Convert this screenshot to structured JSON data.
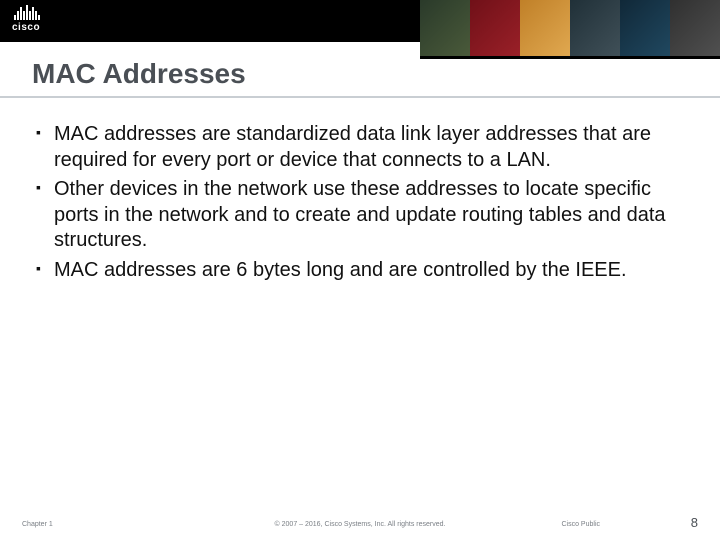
{
  "brand": "cisco",
  "title": "MAC Addresses",
  "bullets": [
    "MAC addresses are standardized data link layer addresses that are required for every port or device that connects to a LAN.",
    "Other devices in the network use these addresses to locate specific ports in the network and to create and update routing tables and data structures.",
    "MAC addresses are 6 bytes long and are controlled by the IEEE."
  ],
  "footer": {
    "chapter": "Chapter 1",
    "copyright": "© 2007 – 2016, Cisco Systems, Inc. All rights reserved.",
    "classification": "Cisco Public",
    "page": "8"
  }
}
